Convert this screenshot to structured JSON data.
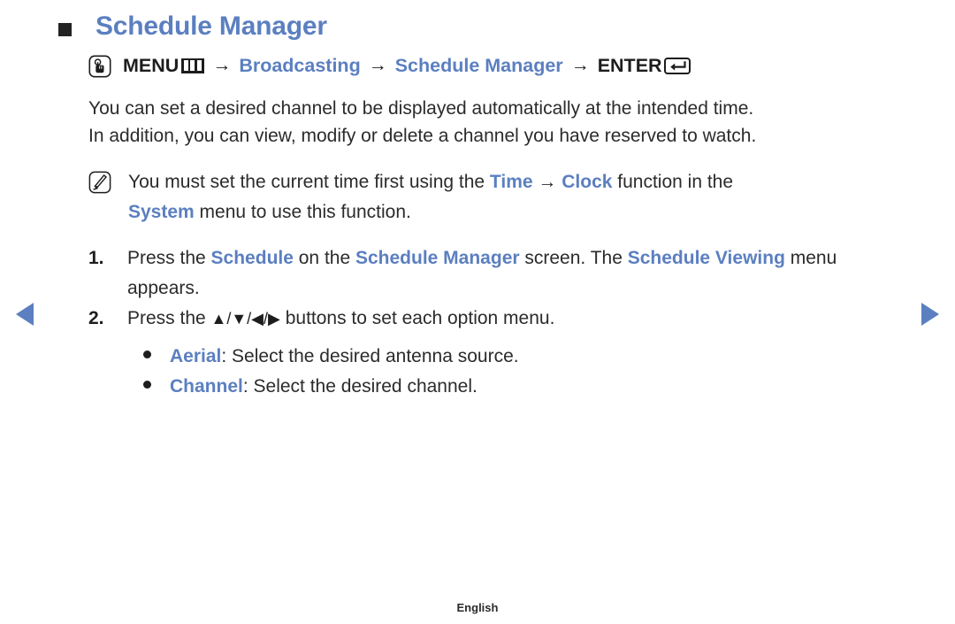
{
  "nav": {
    "prev_label": "Previous page",
    "next_label": "Next page",
    "color": "#5b7fc0"
  },
  "heading": {
    "title": "Schedule Manager",
    "bullet_color": "#232323",
    "title_color": "#5b7fc0"
  },
  "menu_path": {
    "key_icon": "menu-touch-key-icon",
    "menu_label": "MENU",
    "menu_glyph": "menu-grid-icon",
    "arrow": "→",
    "step1": "Broadcasting",
    "step2": "Schedule Manager",
    "enter_label": "ENTER",
    "enter_glyph": "enter-return-key-icon"
  },
  "intro": {
    "line1": "You can set a desired channel to be displayed automatically at the intended time.",
    "line2": "In addition, you can view, modify or delete a channel you have reserved to watch."
  },
  "note": {
    "icon": "note-pencil-icon",
    "text_a": "You must set the current time first using the ",
    "term_time": "Time",
    "arrow": "→",
    "term_clock": "Clock",
    "text_b": " function in the",
    "term_system": "System",
    "text_c": " menu to use this function."
  },
  "steps": [
    {
      "number": "1.",
      "text_a": "Press the ",
      "term_1": "Schedule",
      "text_b": " on the ",
      "term_2": "Schedule Manager",
      "text_c": " screen. The ",
      "term_3": "Schedule Viewing",
      "text_d": " menu appears."
    },
    {
      "number": "2.",
      "text_a": "Press the ",
      "buttons": "▲/▼/◀/▶",
      "text_b": " buttons to set each option menu."
    }
  ],
  "bullets": [
    {
      "term": "Aerial",
      "text": ": Select the desired antenna source."
    },
    {
      "term": "Channel",
      "text": ": Select the desired channel."
    }
  ],
  "footer": {
    "language": "English"
  }
}
